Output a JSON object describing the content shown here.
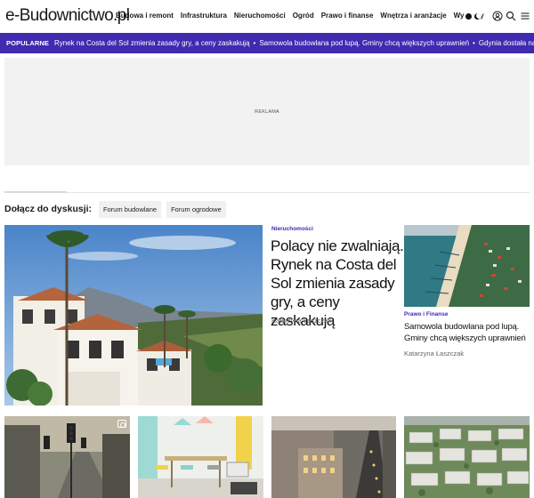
{
  "header": {
    "logo": "e-Budownictwo.pl",
    "nav": [
      "Budowa i remont",
      "Infrastruktura",
      "Nieruchomości",
      "Ogród",
      "Prawo i finanse",
      "Wnętrza i aranżacje",
      "Wywiady"
    ],
    "icons": [
      "theme-toggle",
      "user-icon",
      "search-icon",
      "menu-icon"
    ]
  },
  "popular": {
    "label": "POPULARNE",
    "items": [
      "Rynek na Costa del Sol zmienia zasady gry, a ceny zaskakują",
      "Samowola budowlana pod lupą. Gminy chcą większych uprawnień",
      "Gdynia dostała najwyższe światowe wyróż"
    ],
    "separator": "•",
    "accent_color": "#3f2ab0"
  },
  "ad": {
    "label": "REKLAMA"
  },
  "discuss": {
    "title": "Dołącz do dyskusji:",
    "chips": [
      "Forum budowlane",
      "Forum ogrodowe"
    ]
  },
  "featured": {
    "category": "Nieruchomości",
    "title": "Polacy nie zwalniają. Rynek na Costa del Sol zmienia zasady gry, a ceny zaskakują",
    "author": "Katarzyna Łaszczak"
  },
  "side_article": {
    "category": "Prawo i Finanse",
    "title": "Samowola budowlana pod lupą. Gminy chcą większych uprawnień",
    "author": "Katarzyna Łaszczak"
  },
  "colors": {
    "brand": "#3f2ab0",
    "ad_bg": "#f2f2f2",
    "chip_bg": "#f0f0f0"
  }
}
